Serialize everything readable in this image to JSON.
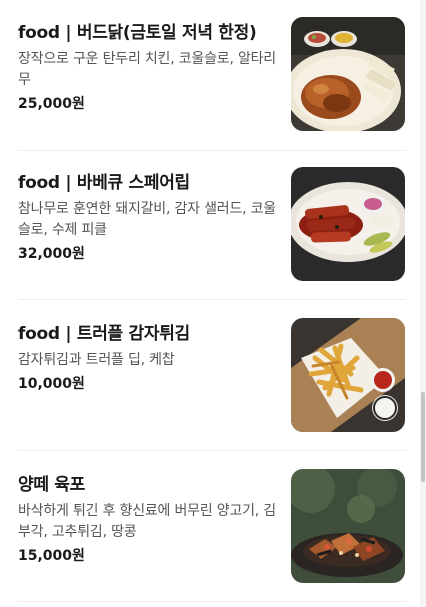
{
  "menu": {
    "items": [
      {
        "name": "food | 버드닭(금토일 저녁 한정)",
        "description": "장작으로 구운 탄두리 치킨, 코울슬로, 알타리 무",
        "price": "25,000원",
        "image_icon": "roast-chicken-photo"
      },
      {
        "name": "food | 바베큐 스페어립",
        "description": "참나무로 훈연한 돼지갈비, 감자 샐러드, 코울슬로, 수제 피클",
        "price": "32,000원",
        "image_icon": "bbq-spare-ribs-photo"
      },
      {
        "name": "food | 트러플 감자튀김",
        "description": "감자튀김과 트러플 딥, 케찹",
        "price": "10,000원",
        "image_icon": "truffle-fries-photo"
      },
      {
        "name": "양떼 육포",
        "description": "바삭하게 튀긴 후 향신료에 버무린 양고기, 김부각, 고추튀김, 땅콩",
        "price": "15,000원",
        "image_icon": "lamb-jerky-photo"
      }
    ]
  }
}
